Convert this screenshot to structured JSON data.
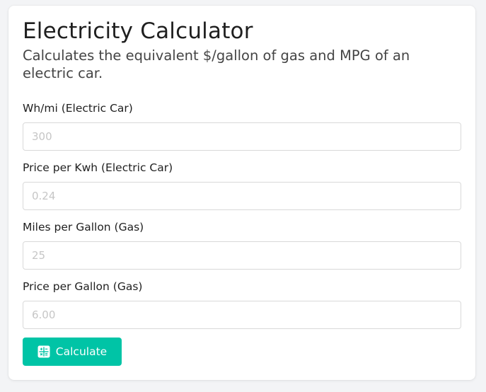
{
  "calculator": {
    "title": "Electricity Calculator",
    "subtitle": "Calculates the equivalent $/gallon of gas and MPG of an electric car.",
    "fields": [
      {
        "label": "Wh/mi (Electric Car)",
        "placeholder": "300"
      },
      {
        "label": "Price per Kwh (Electric Car)",
        "placeholder": "0.24"
      },
      {
        "label": "Miles per Gallon (Gas)",
        "placeholder": "25"
      },
      {
        "label": "Price per Gallon (Gas)",
        "placeholder": "6.00"
      }
    ],
    "calculate_button": {
      "label": "Calculate",
      "icon": "calculator-icon"
    }
  },
  "colors": {
    "accent": "#00c4a6",
    "background": "#f3f4f6",
    "card": "#ffffff"
  }
}
